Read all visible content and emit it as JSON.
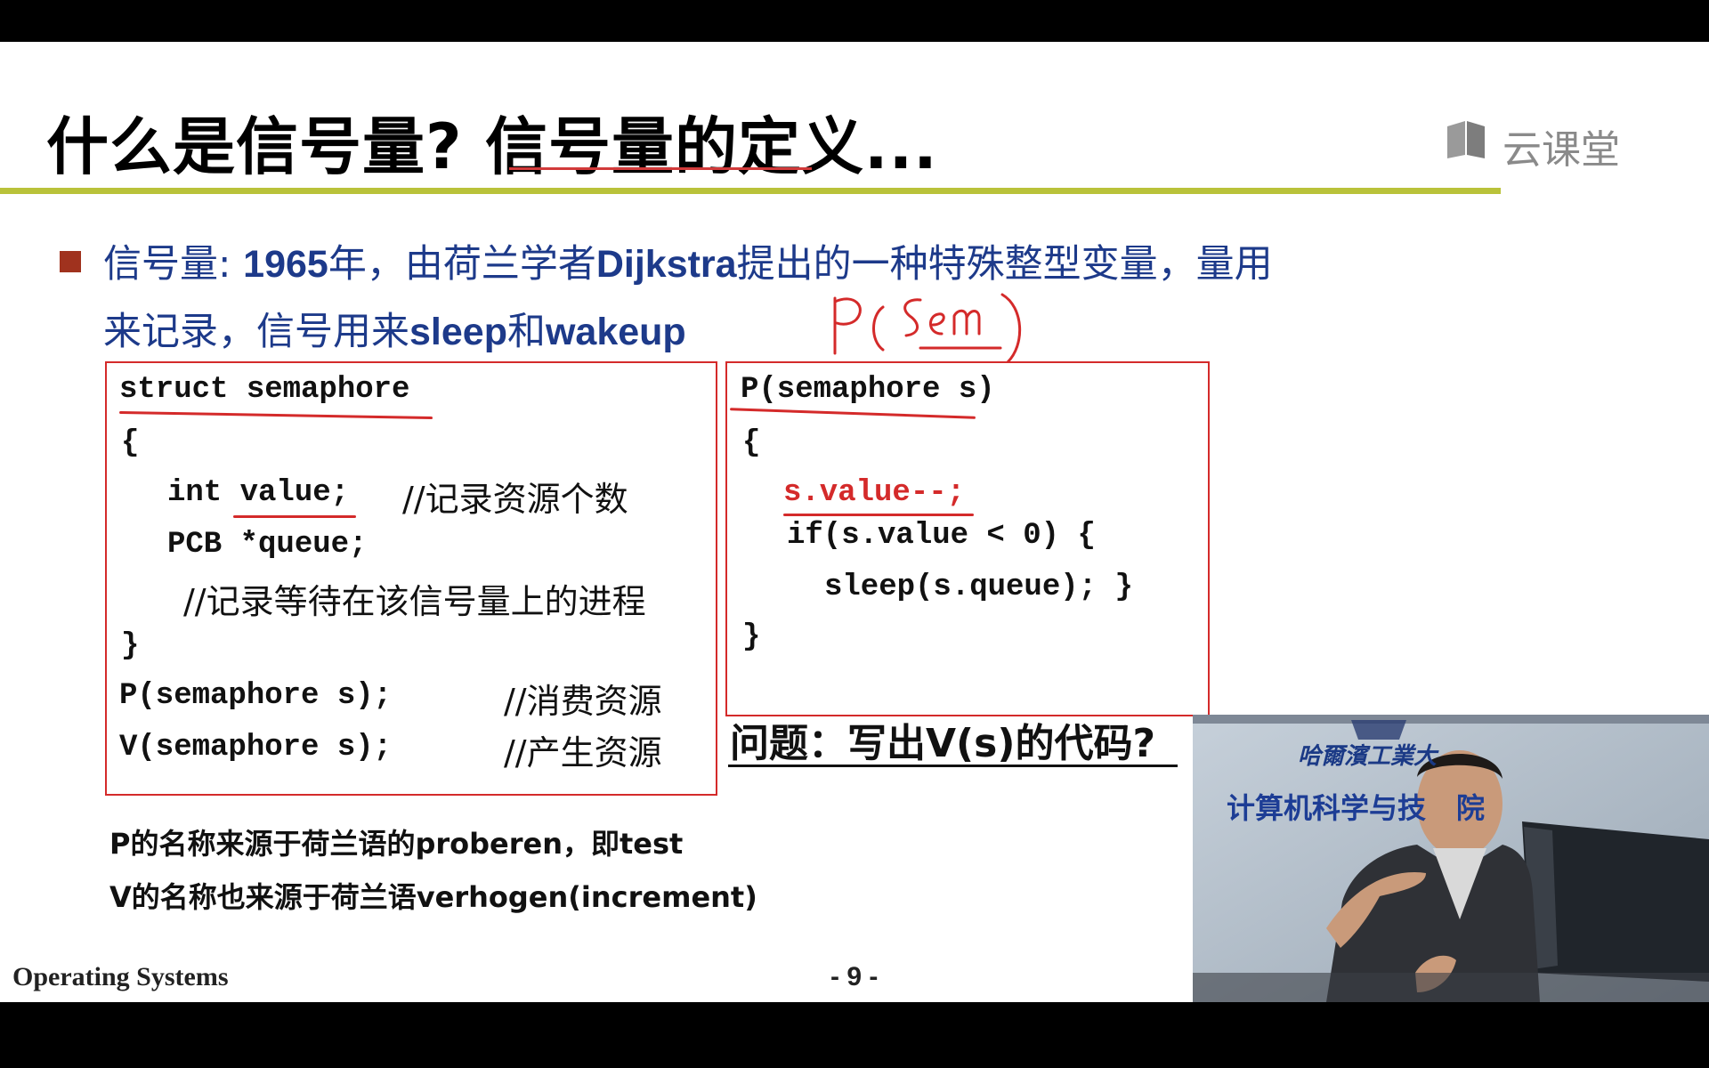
{
  "slide": {
    "title": "什么是信号量? 信号量的定义...",
    "logo_text": "云课堂",
    "bullet_line1_a": "信号量: ",
    "bullet_line1_b": "1965",
    "bullet_line1_c": "年，由荷兰学者",
    "bullet_line1_d": "Dijkstra",
    "bullet_line1_e": "提出的一种特殊整型变量，量用",
    "bullet_line2_a": "来记录，信号用来",
    "bullet_line2_b": "sleep",
    "bullet_line2_c": "和",
    "bullet_line2_d": "wakeup",
    "handwriting": "P(sem)",
    "left_box": {
      "l1": "struct semaphore",
      "l2": "{",
      "l3_code": "int value;",
      "l3_cmt": "//记录资源个数",
      "l4": "PCB *queue;",
      "l5_cmt": "//记录等待在该信号量上的进程",
      "l6": "}",
      "l7_code": "P(semaphore s);",
      "l7_cmt": "//消费资源",
      "l8_code": "V(semaphore s);",
      "l8_cmt": "//产生资源"
    },
    "right_box": {
      "l1": "P(semaphore s)",
      "l2": "{",
      "l3": "s.value--;",
      "l4": "if(s.value < 0) {",
      "l5": "sleep(s.queue); }",
      "l6": "}"
    },
    "question": "问题：写出V(s)的代码?",
    "note1": "P的名称来源于荷兰语的proberen，即test",
    "note2": "V的名称也来源于荷兰语verhogen(increment)",
    "footer_left": "Operating Systems",
    "footer_page": "- 9 -"
  },
  "video": {
    "sign_line1": "哈爾濱工業大",
    "sign_line2": "计算机科学与技",
    "sign_line2_end": "院"
  }
}
